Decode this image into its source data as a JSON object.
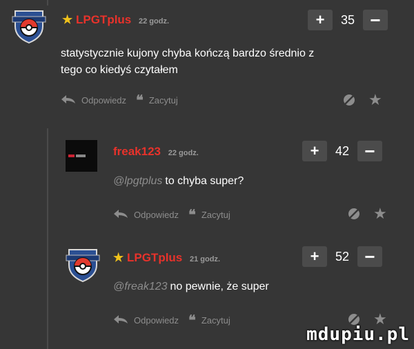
{
  "comments": [
    {
      "username": "LPGTplus",
      "time": "22 godz.",
      "score": "35",
      "text_lines": [
        "statystycznie kujony chyba kończą bardzo średnio z",
        "tego co kiedyś czytałem"
      ],
      "reply_label": "Odpowiedz",
      "quote_label": "Zacytuj"
    },
    {
      "username": "freak123",
      "time": "22 godz.",
      "score": "42",
      "mention": "@lpgtplus",
      "text": "to chyba super?",
      "reply_label": "Odpowiedz",
      "quote_label": "Zacytuj"
    },
    {
      "username": "LPGTplus",
      "time": "21 godz.",
      "score": "52",
      "mention": "@freak123",
      "text": "no pewnie, że super",
      "reply_label": "Odpowiedz",
      "quote_label": "Zacytuj"
    }
  ],
  "vote": {
    "plus": "+",
    "minus": "−"
  },
  "watermark": "mdupiu.pl",
  "colors": {
    "background": "#363636",
    "username": "#e8322b",
    "star": "#f0c21b",
    "muted": "#8d8d8d"
  }
}
